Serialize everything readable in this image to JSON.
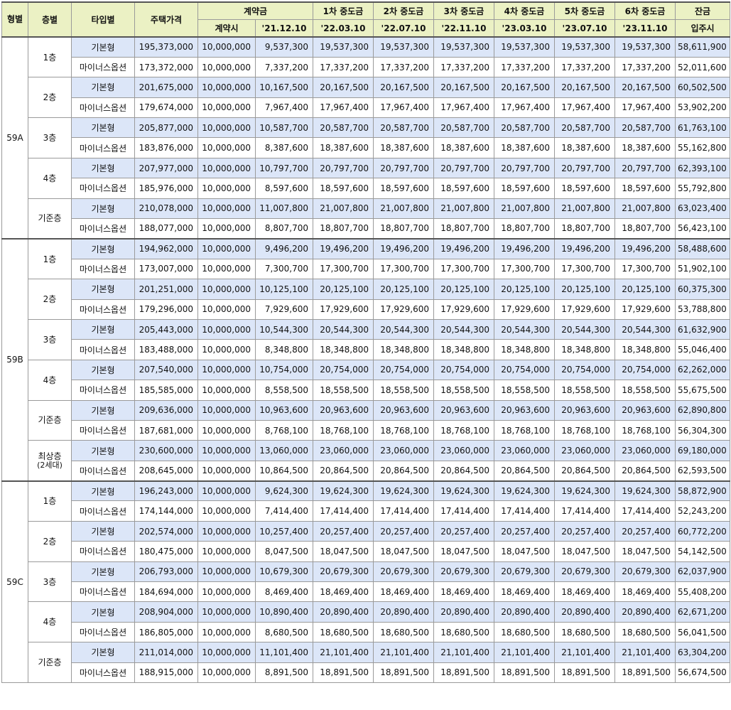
{
  "headers": {
    "unit": "형별",
    "floor": "층별",
    "type": "타입별",
    "price": "주택가격",
    "contract": "계약금",
    "contract_sub1": "계약시",
    "contract_sub2": "'21.12.10",
    "mid1": "1차 중도금",
    "mid1_date": "'22.03.10",
    "mid2": "2차 중도금",
    "mid2_date": "'22.07.10",
    "mid3": "3차 중도금",
    "mid3_date": "'22.11.10",
    "mid4": "4차 중도금",
    "mid4_date": "'23.03.10",
    "mid5": "5차 중도금",
    "mid5_date": "'23.07.10",
    "mid6": "6차 중도금",
    "mid6_date": "'23.11.10",
    "balance": "잔금",
    "balance_sub": "입주시"
  },
  "groups": [
    {
      "unit": "59A",
      "floors": [
        {
          "floor": "1층",
          "floor_sub": "",
          "rows": [
            {
              "type": "기본형",
              "price": "195,373,000",
              "c1": "10,000,000",
              "c2": "9,537,300",
              "m": "19,537,300",
              "bal": "58,611,900"
            },
            {
              "type": "마이너스옵션",
              "price": "173,372,000",
              "c1": "10,000,000",
              "c2": "7,337,200",
              "m": "17,337,200",
              "bal": "52,011,600"
            }
          ]
        },
        {
          "floor": "2층",
          "floor_sub": "",
          "rows": [
            {
              "type": "기본형",
              "price": "201,675,000",
              "c1": "10,000,000",
              "c2": "10,167,500",
              "m": "20,167,500",
              "bal": "60,502,500"
            },
            {
              "type": "마이너스옵션",
              "price": "179,674,000",
              "c1": "10,000,000",
              "c2": "7,967,400",
              "m": "17,967,400",
              "bal": "53,902,200"
            }
          ]
        },
        {
          "floor": "3층",
          "floor_sub": "",
          "rows": [
            {
              "type": "기본형",
              "price": "205,877,000",
              "c1": "10,000,000",
              "c2": "10,587,700",
              "m": "20,587,700",
              "bal": "61,763,100"
            },
            {
              "type": "마이너스옵션",
              "price": "183,876,000",
              "c1": "10,000,000",
              "c2": "8,387,600",
              "m": "18,387,600",
              "bal": "55,162,800"
            }
          ]
        },
        {
          "floor": "4층",
          "floor_sub": "",
          "rows": [
            {
              "type": "기본형",
              "price": "207,977,000",
              "c1": "10,000,000",
              "c2": "10,797,700",
              "m": "20,797,700",
              "bal": "62,393,100"
            },
            {
              "type": "마이너스옵션",
              "price": "185,976,000",
              "c1": "10,000,000",
              "c2": "8,597,600",
              "m": "18,597,600",
              "bal": "55,792,800"
            }
          ]
        },
        {
          "floor": "기준층",
          "floor_sub": "",
          "rows": [
            {
              "type": "기본형",
              "price": "210,078,000",
              "c1": "10,000,000",
              "c2": "11,007,800",
              "m": "21,007,800",
              "bal": "63,023,400"
            },
            {
              "type": "마이너스옵션",
              "price": "188,077,000",
              "c1": "10,000,000",
              "c2": "8,807,700",
              "m": "18,807,700",
              "bal": "56,423,100"
            }
          ]
        }
      ]
    },
    {
      "unit": "59B",
      "floors": [
        {
          "floor": "1층",
          "floor_sub": "",
          "rows": [
            {
              "type": "기본형",
              "price": "194,962,000",
              "c1": "10,000,000",
              "c2": "9,496,200",
              "m": "19,496,200",
              "bal": "58,488,600"
            },
            {
              "type": "마이너스옵션",
              "price": "173,007,000",
              "c1": "10,000,000",
              "c2": "7,300,700",
              "m": "17,300,700",
              "bal": "51,902,100"
            }
          ]
        },
        {
          "floor": "2층",
          "floor_sub": "",
          "rows": [
            {
              "type": "기본형",
              "price": "201,251,000",
              "c1": "10,000,000",
              "c2": "10,125,100",
              "m": "20,125,100",
              "bal": "60,375,300"
            },
            {
              "type": "마이너스옵션",
              "price": "179,296,000",
              "c1": "10,000,000",
              "c2": "7,929,600",
              "m": "17,929,600",
              "bal": "53,788,800"
            }
          ]
        },
        {
          "floor": "3층",
          "floor_sub": "",
          "rows": [
            {
              "type": "기본형",
              "price": "205,443,000",
              "c1": "10,000,000",
              "c2": "10,544,300",
              "m": "20,544,300",
              "bal": "61,632,900"
            },
            {
              "type": "마이너스옵션",
              "price": "183,488,000",
              "c1": "10,000,000",
              "c2": "8,348,800",
              "m": "18,348,800",
              "bal": "55,046,400"
            }
          ]
        },
        {
          "floor": "4층",
          "floor_sub": "",
          "rows": [
            {
              "type": "기본형",
              "price": "207,540,000",
              "c1": "10,000,000",
              "c2": "10,754,000",
              "m": "20,754,000",
              "bal": "62,262,000"
            },
            {
              "type": "마이너스옵션",
              "price": "185,585,000",
              "c1": "10,000,000",
              "c2": "8,558,500",
              "m": "18,558,500",
              "bal": "55,675,500"
            }
          ]
        },
        {
          "floor": "기준층",
          "floor_sub": "",
          "rows": [
            {
              "type": "기본형",
              "price": "209,636,000",
              "c1": "10,000,000",
              "c2": "10,963,600",
              "m": "20,963,600",
              "bal": "62,890,800"
            },
            {
              "type": "마이너스옵션",
              "price": "187,681,000",
              "c1": "10,000,000",
              "c2": "8,768,100",
              "m": "18,768,100",
              "bal": "56,304,300"
            }
          ]
        },
        {
          "floor": "최상층",
          "floor_sub": "(2세대)",
          "rows": [
            {
              "type": "기본형",
              "price": "230,600,000",
              "c1": "10,000,000",
              "c2": "13,060,000",
              "m": "23,060,000",
              "bal": "69,180,000"
            },
            {
              "type": "마이너스옵션",
              "price": "208,645,000",
              "c1": "10,000,000",
              "c2": "10,864,500",
              "m": "20,864,500",
              "bal": "62,593,500"
            }
          ]
        }
      ]
    },
    {
      "unit": "59C",
      "floors": [
        {
          "floor": "1층",
          "floor_sub": "",
          "rows": [
            {
              "type": "기본형",
              "price": "196,243,000",
              "c1": "10,000,000",
              "c2": "9,624,300",
              "m": "19,624,300",
              "bal": "58,872,900"
            },
            {
              "type": "마이너스옵션",
              "price": "174,144,000",
              "c1": "10,000,000",
              "c2": "7,414,400",
              "m": "17,414,400",
              "bal": "52,243,200"
            }
          ]
        },
        {
          "floor": "2층",
          "floor_sub": "",
          "rows": [
            {
              "type": "기본형",
              "price": "202,574,000",
              "c1": "10,000,000",
              "c2": "10,257,400",
              "m": "20,257,400",
              "bal": "60,772,200"
            },
            {
              "type": "마이너스옵션",
              "price": "180,475,000",
              "c1": "10,000,000",
              "c2": "8,047,500",
              "m": "18,047,500",
              "bal": "54,142,500"
            }
          ]
        },
        {
          "floor": "3층",
          "floor_sub": "",
          "rows": [
            {
              "type": "기본형",
              "price": "206,793,000",
              "c1": "10,000,000",
              "c2": "10,679,300",
              "m": "20,679,300",
              "bal": "62,037,900"
            },
            {
              "type": "마이너스옵션",
              "price": "184,694,000",
              "c1": "10,000,000",
              "c2": "8,469,400",
              "m": "18,469,400",
              "bal": "55,408,200"
            }
          ]
        },
        {
          "floor": "4층",
          "floor_sub": "",
          "rows": [
            {
              "type": "기본형",
              "price": "208,904,000",
              "c1": "10,000,000",
              "c2": "10,890,400",
              "m": "20,890,400",
              "bal": "62,671,200"
            },
            {
              "type": "마이너스옵션",
              "price": "186,805,000",
              "c1": "10,000,000",
              "c2": "8,680,500",
              "m": "18,680,500",
              "bal": "56,041,500"
            }
          ]
        },
        {
          "floor": "기준층",
          "floor_sub": "",
          "rows": [
            {
              "type": "기본형",
              "price": "211,014,000",
              "c1": "10,000,000",
              "c2": "11,101,400",
              "m": "21,101,400",
              "bal": "63,304,200"
            },
            {
              "type": "마이너스옵션",
              "price": "188,915,000",
              "c1": "10,000,000",
              "c2": "8,891,500",
              "m": "18,891,500",
              "bal": "56,674,500"
            }
          ]
        }
      ]
    }
  ]
}
